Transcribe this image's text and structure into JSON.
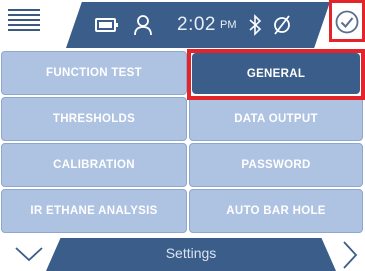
{
  "status_bar": {
    "time": "2:02",
    "ampm": "PM",
    "icons": [
      "menu-icon",
      "battery-icon",
      "user-icon",
      "bluetooth-icon",
      "no-connection-icon",
      "confirm-check-icon"
    ]
  },
  "menu": {
    "items": [
      {
        "label": "FUNCTION TEST"
      },
      {
        "label": "GENERAL",
        "selected": true
      },
      {
        "label": "THRESHOLDS"
      },
      {
        "label": "DATA OUTPUT"
      },
      {
        "label": "CALIBRATION"
      },
      {
        "label": "PASSWORD"
      },
      {
        "label": "IR ETHANE ANALYSIS"
      },
      {
        "label": "AUTO BAR HOLE"
      }
    ]
  },
  "bottom_nav": {
    "title": "Settings"
  },
  "colors": {
    "primary": "#3a5d8a",
    "tile": "#aec2e2",
    "highlight": "#e3242b"
  }
}
